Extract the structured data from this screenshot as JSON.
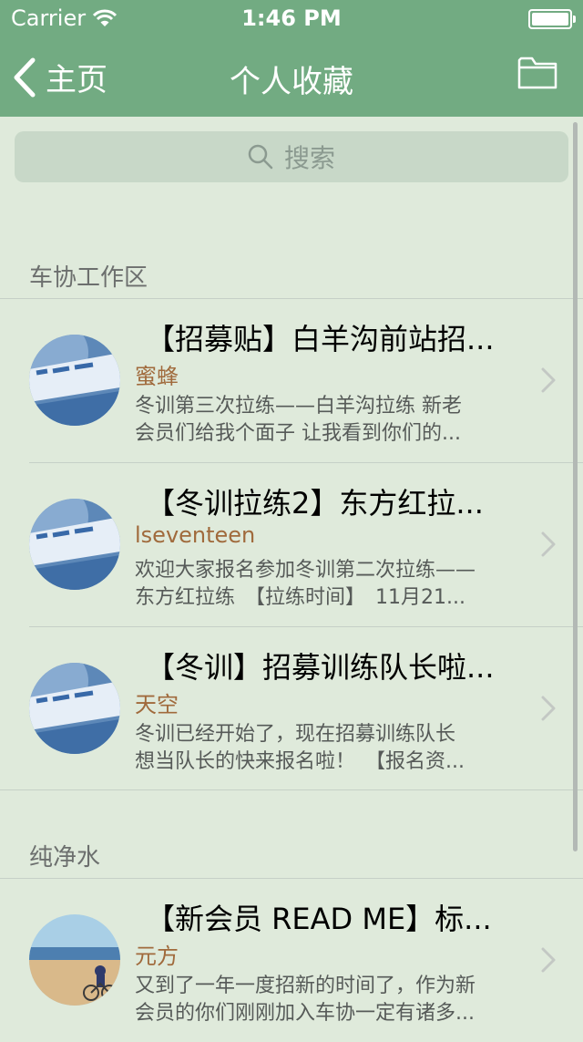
{
  "status_bar": {
    "carrier": "Carrier",
    "time": "1:46 PM"
  },
  "nav": {
    "back_label": "主页",
    "title": "个人收藏",
    "right_icon": "folder-icon"
  },
  "search": {
    "placeholder": "搜索",
    "icon": "search-icon"
  },
  "sections": [
    {
      "header": "车协工作区",
      "items": [
        {
          "title": "【招募贴】白羊沟前站招...",
          "author": "蜜蜂",
          "summary_line1": "冬训第三次拉练——白羊沟拉练 新老",
          "summary_line2": "会员们给我个面子 让我看到你们的..."
        },
        {
          "title": "【冬训拉练2】东方红拉...",
          "author": "lseventeen",
          "summary_line1": "欢迎大家报名参加冬训第二次拉练——",
          "summary_line2": "东方红拉练　【拉练时间】　11月21..."
        },
        {
          "title": "【冬训】招募训练队长啦...",
          "author": "天空",
          "summary_line1": "冬训已经开始了，现在招募训练队长",
          "summary_line2": "想当队长的快来报名啦！　【报名资..."
        }
      ]
    },
    {
      "header": "纯净水",
      "items": [
        {
          "title": "【新会员 READ ME】标...",
          "author": "元方",
          "summary_line1": "又到了一年一度招新的时间了，作为新",
          "summary_line2": "会员的你们刚刚加入车协一定有诸多..."
        }
      ]
    }
  ],
  "colors": {
    "nav_bg": "#72ab82",
    "page_bg": "#dfeadb",
    "author": "#a06a3c"
  }
}
